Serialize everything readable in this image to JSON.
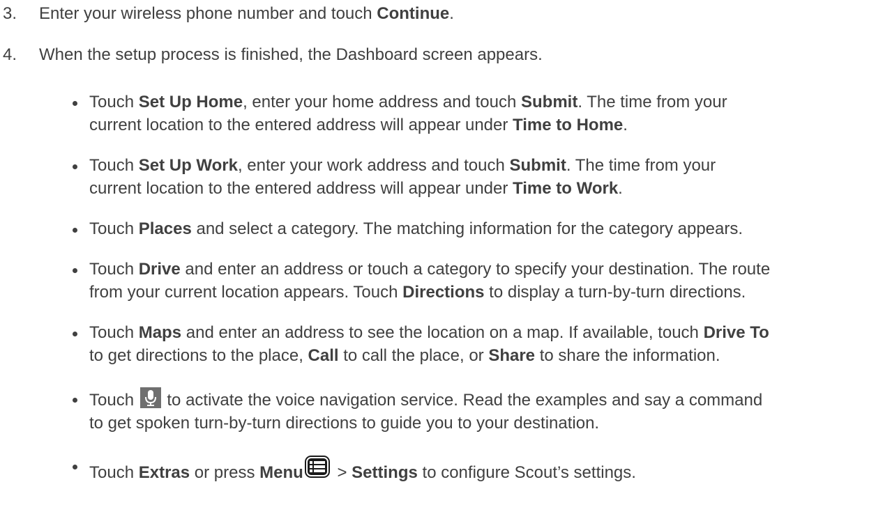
{
  "steps": [
    {
      "number": "3.",
      "parts": [
        "Enter your wireless phone number and touch ",
        "Continue",
        "."
      ]
    },
    {
      "number": "4.",
      "text": "When the setup process is finished, the Dashboard screen appears."
    }
  ],
  "bullets": {
    "home": {
      "l1a": "Touch ",
      "l1b": "Set Up Home",
      "l1c": ", enter your home address and touch ",
      "l1d": "Submit",
      "l1e": ". The time from your",
      "l2a": "current location to the entered address will appear under ",
      "l2b": "Time to Home",
      "l2c": "."
    },
    "work": {
      "l1a": "Touch ",
      "l1b": "Set Up Work",
      "l1c": ", enter your work address and touch ",
      "l1d": "Submit",
      "l1e": ". The time from your",
      "l2a": "current location to the entered address will appear under ",
      "l2b": "Time to Work",
      "l2c": "."
    },
    "places": {
      "a": "Touch ",
      "b": "Places",
      "c": " and select a category. The matching information for the category appears."
    },
    "drive": {
      "l1a": "Touch ",
      "l1b": "Drive",
      "l1c": " and enter an address or touch a category to specify your destination. The route",
      "l2a": "from your current location appears. Touch ",
      "l2b": "Directions",
      "l2c": " to display a turn-by-turn directions."
    },
    "maps": {
      "l1a": "Touch ",
      "l1b": "Maps",
      "l1c": " and enter an address to see the location on a map. If available, touch ",
      "l1d": "Drive To",
      "l2a": "to get directions to the place, ",
      "l2b": "Call",
      "l2c": " to call the place, or ",
      "l2d": "Share",
      "l2e": " to share the information."
    },
    "voice": {
      "l1a": "Touch ",
      "icon": "microphone-icon",
      "l1b": " to activate the voice navigation service. Read the examples and say a command",
      "l2": "to get spoken turn-by-turn directions to guide you to your destination."
    },
    "extras": {
      "a": "Touch ",
      "b": "Extras",
      "c": " or press ",
      "d": "Menu",
      "icon": "menu-list-icon",
      "e": " > ",
      "f": "Settings",
      "g": " to configure Scout’s settings."
    }
  },
  "colors": {
    "text": "#404040",
    "icon_bg": "#6f6f6f",
    "icon_fg": "#ffffff"
  }
}
